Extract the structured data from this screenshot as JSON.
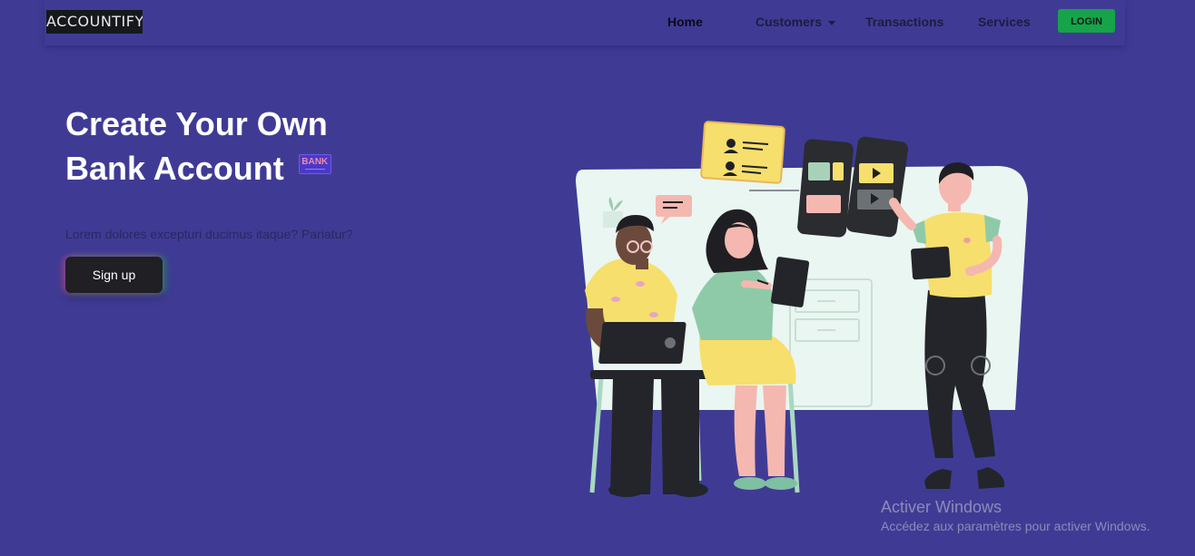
{
  "nav": {
    "logo": "ACCOUNTIFY",
    "links": [
      {
        "label": "Home",
        "active": true
      },
      {
        "label": "Customers",
        "dropdown": true
      },
      {
        "label": "Transactions"
      },
      {
        "label": "Services"
      }
    ],
    "login_label": "LOGIN"
  },
  "hero": {
    "title_line1": "Create Your Own",
    "title_line2": "Bank Account",
    "badge_label": "BANK",
    "subtitle": "Lorem dolores excepturi ducimus itaque? Pariatur?",
    "cta_label": "Sign up"
  },
  "watermark": {
    "title": "Activer Windows",
    "subtitle": "Accédez aux paramètres pour activer Windows."
  },
  "colors": {
    "background": "#3f3b95",
    "login_button": "#16a34a",
    "cta_button": "#1f1f24",
    "illustration_panel": "#eaf6f1",
    "accent_yellow": "#f6df6c"
  },
  "illustration": {
    "subject": "people-collaborating-with-devices"
  }
}
